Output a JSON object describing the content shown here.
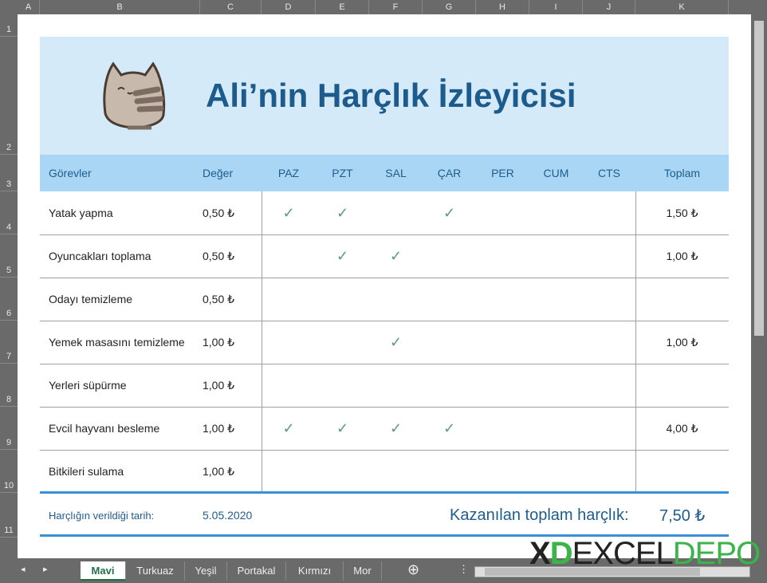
{
  "columns": [
    "A",
    "B",
    "C",
    "D",
    "E",
    "F",
    "G",
    "H",
    "I",
    "J",
    "K"
  ],
  "rows": [
    "1",
    "2",
    "3",
    "4",
    "5",
    "6",
    "7",
    "8",
    "9",
    "10",
    "11"
  ],
  "title": "Ali’nin Harçlık İzleyicisi",
  "headers": {
    "task": "Görevler",
    "value": "Değer",
    "days": [
      "PAZ",
      "PZT",
      "SAL",
      "ÇAR",
      "PER",
      "CUM",
      "CTS"
    ],
    "total": "Toplam"
  },
  "tasks": [
    {
      "name": "Yatak yapma",
      "value": "0,50 ₺",
      "checks": [
        true,
        true,
        false,
        true,
        false,
        false,
        false
      ],
      "total": "1,50 ₺"
    },
    {
      "name": "Oyuncakları toplama",
      "value": "0,50 ₺",
      "checks": [
        false,
        true,
        true,
        false,
        false,
        false,
        false
      ],
      "total": "1,00 ₺"
    },
    {
      "name": "Odayı temizleme",
      "value": "0,50 ₺",
      "checks": [
        false,
        false,
        false,
        false,
        false,
        false,
        false
      ],
      "total": ""
    },
    {
      "name": "Yemek masasını temizleme",
      "value": "1,00 ₺",
      "checks": [
        false,
        false,
        true,
        false,
        false,
        false,
        false
      ],
      "total": "1,00 ₺"
    },
    {
      "name": "Yerleri süpürme",
      "value": "1,00 ₺",
      "checks": [
        false,
        false,
        false,
        false,
        false,
        false,
        false
      ],
      "total": ""
    },
    {
      "name": "Evcil hayvanı besleme",
      "value": "1,00 ₺",
      "checks": [
        true,
        true,
        true,
        true,
        false,
        false,
        false
      ],
      "total": "4,00 ₺"
    },
    {
      "name": "Bitkileri sulama",
      "value": "1,00 ₺",
      "checks": [
        false,
        false,
        false,
        false,
        false,
        false,
        false
      ],
      "total": ""
    }
  ],
  "check_symbol": "✓",
  "footer": {
    "date_label": "Harçlığın verildiği tarih:",
    "date": "5.05.2020",
    "total_label": "Kazanılan toplam harçlık:",
    "total": "7,50 ₺"
  },
  "tabs": [
    "Mavi",
    "Turkuaz",
    "Yeşil",
    "Portakal",
    "Kırmızı",
    "Mor"
  ],
  "active_tab": "Mavi",
  "add_sheet": "⊕",
  "watermark": {
    "x": "X",
    "d": "D",
    "excel": "EXCEL",
    "depo": "DEPO"
  },
  "colors": {
    "banner": "#d5eaf8",
    "header": "#a9d6f5",
    "title": "#1d5b8d",
    "accent_line": "#3a8fd6",
    "check": "#5f9a7a"
  }
}
